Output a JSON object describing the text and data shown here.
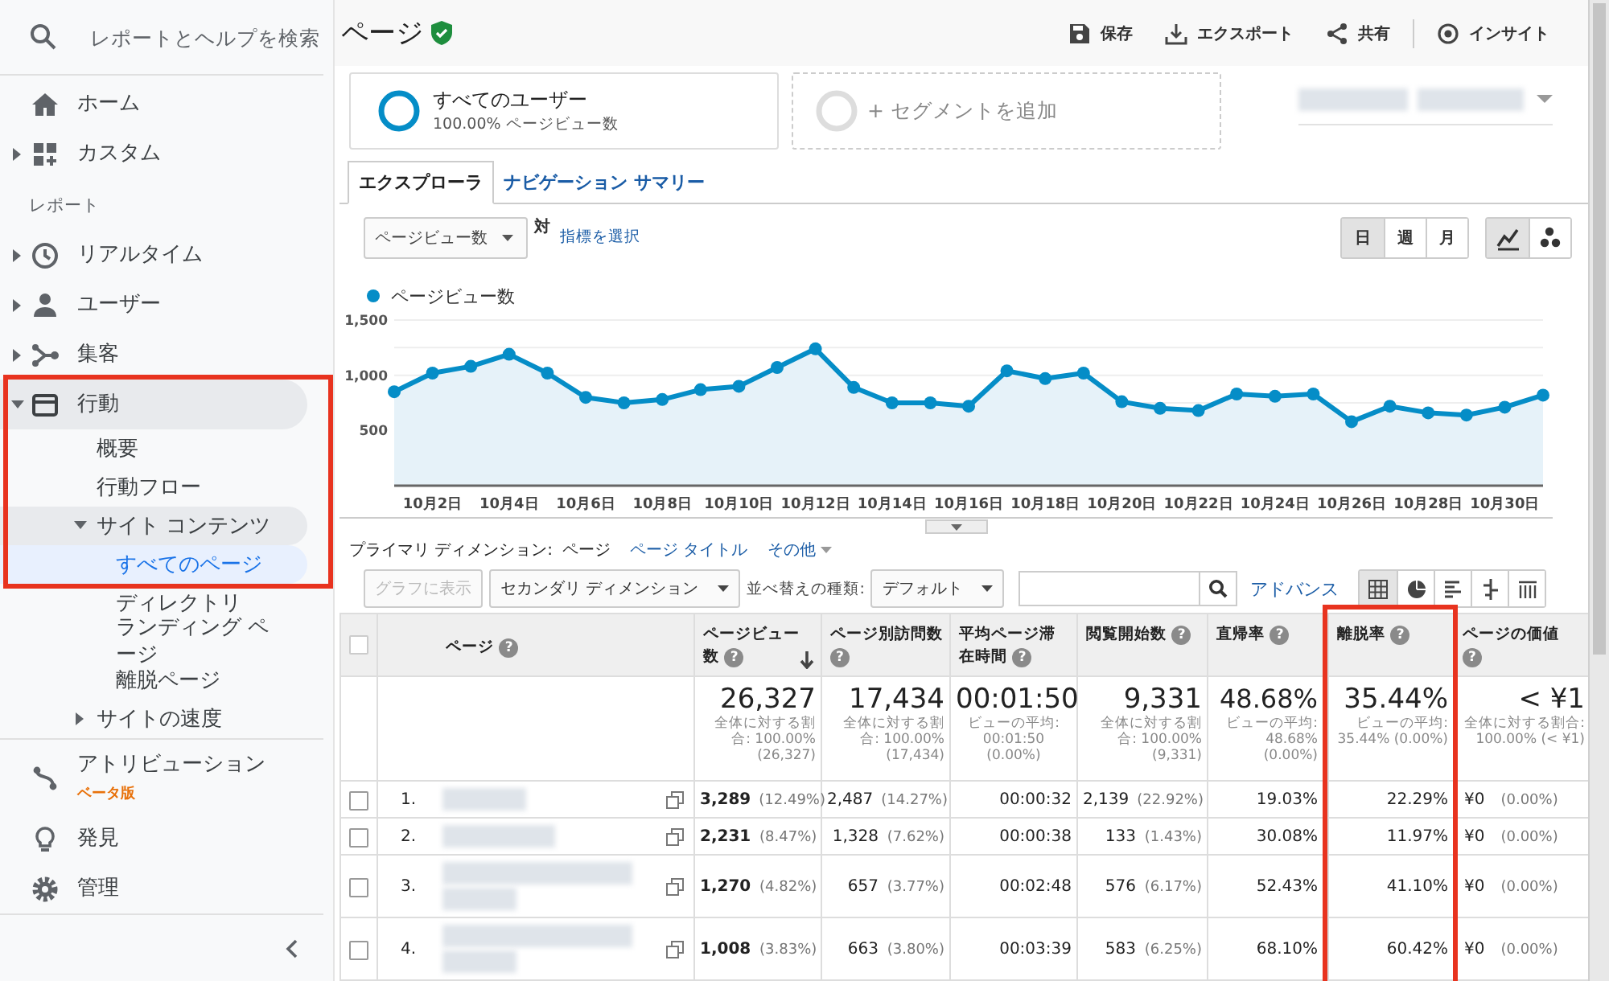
{
  "sidebar": {
    "search": {
      "placeholder": "レポートとヘルプを検索"
    },
    "top_items": [
      {
        "label": "ホーム",
        "selected": false
      },
      {
        "label": "カスタム",
        "expanded": false,
        "selected": false
      }
    ],
    "section_label": "レポート",
    "report_items": [
      {
        "label": "リアルタイム",
        "expanded": false,
        "selected": false
      },
      {
        "label": "ユーザー",
        "expanded": false,
        "selected": false
      },
      {
        "label": "集客",
        "expanded": false,
        "selected": false
      },
      {
        "label": "行動",
        "expanded": true,
        "selected": false,
        "highlighted": true,
        "children": [
          {
            "label": "概要",
            "selected": false
          },
          {
            "label": "行動フロー",
            "selected": false
          },
          {
            "label": "サイト コンテンツ",
            "expanded": true,
            "selected": false,
            "children": [
              {
                "label": "すべてのページ",
                "selected": true
              },
              {
                "label": "ディレクトリ",
                "selected": false
              },
              {
                "label": "ランディング ページ",
                "selected": false
              },
              {
                "label": "離脱ページ",
                "selected": false
              }
            ]
          },
          {
            "label": "サイトの速度",
            "expanded": false,
            "selected": false
          }
        ]
      }
    ],
    "bottom_items": [
      {
        "label": "アトリビューション",
        "badge": "ベータ版",
        "selected": false
      },
      {
        "label": "発見",
        "selected": false
      },
      {
        "label": "管理",
        "selected": false
      }
    ]
  },
  "header": {
    "title": "ページ",
    "verified": true,
    "actions": [
      {
        "label": "保存"
      },
      {
        "label": "エクスポート"
      },
      {
        "label": "共有"
      },
      {
        "label": "インサイト"
      }
    ]
  },
  "segments": [
    {
      "kind": "active",
      "name": "すべてのユーザー",
      "detail": "100.00% ページビュー数"
    },
    {
      "kind": "add",
      "name": "+ セグメントを追加"
    }
  ],
  "date_range": {
    "kind": "redacted"
  },
  "tabs": [
    {
      "label": "エクスプローラ",
      "selected": true
    },
    {
      "label": "ナビゲーション サマリー",
      "selected": false
    }
  ],
  "chart_controls": {
    "metric": "ページビュー数",
    "versus": "対",
    "pick_metric": "指標を選択",
    "periods": [
      {
        "label": "日",
        "selected": true
      },
      {
        "label": "週",
        "selected": false
      },
      {
        "label": "月",
        "selected": false
      }
    ],
    "chart_types": [
      {
        "selected": true
      },
      {
        "selected": false
      }
    ]
  },
  "chart": {
    "chart_data": {
      "type": "area",
      "categories": [
        null,
        "10月2日",
        null,
        "10月4日",
        null,
        "10月6日",
        null,
        "10月8日",
        null,
        "10月10日",
        null,
        "10月12日",
        null,
        "10月14日",
        null,
        "10月16日",
        null,
        "10月18日",
        null,
        "10月20日",
        null,
        "10月22日",
        null,
        "10月24日",
        null,
        "10月26日",
        null,
        "10月28日",
        null,
        "10月30日",
        null
      ],
      "ylim": [
        0,
        1500
      ],
      "yticks": [
        {
          "value": 500,
          "label": "500"
        },
        {
          "value": 1000,
          "label": "1,000"
        },
        {
          "value": 1500,
          "label": "1,500"
        }
      ],
      "series": [
        {
          "name": "ページビュー数",
          "color": "#058dc7",
          "values": [
            850,
            1020,
            1080,
            1190,
            1020,
            800,
            750,
            780,
            870,
            900,
            1070,
            1240,
            890,
            750,
            750,
            720,
            1040,
            970,
            1020,
            760,
            700,
            680,
            830,
            810,
            830,
            580,
            720,
            660,
            640,
            710,
            820
          ]
        }
      ]
    }
  },
  "primary_dimension": {
    "label": "プライマリ ディメンション:",
    "options": [
      {
        "label": "ページ",
        "selected": true
      },
      {
        "label": "ページ タイトル",
        "selected": false
      },
      {
        "label": "その他",
        "selected": false,
        "kind": "menu"
      }
    ]
  },
  "toolbar": {
    "plot_button": {
      "label": "グラフに表示",
      "disabled": true
    },
    "secondary": "セカンダリ ディメンション",
    "sort_label": "並べ替えの種類:",
    "sort": "デフォルト",
    "advanced": "アドバンス",
    "views": [
      {
        "selected": true
      },
      {
        "selected": false
      },
      {
        "selected": false
      },
      {
        "selected": false
      },
      {
        "selected": false
      }
    ]
  },
  "table": {
    "all_checked": false,
    "columns": [
      {
        "label": "ページ",
        "help": "?",
        "sorted": false
      },
      {
        "label": "ページビュー数",
        "help": "?",
        "sorted": true
      },
      {
        "label": "ページ別訪問数",
        "help": "?",
        "sorted": false
      },
      {
        "label": "平均ページ滞在時間",
        "help": "?",
        "sorted": false
      },
      {
        "label": "閲覧開始数",
        "help": "?",
        "sorted": false
      },
      {
        "label": "直帰率",
        "help": "?",
        "sorted": false
      },
      {
        "label": "離脱率",
        "help": "?",
        "sorted": false,
        "highlighted": true
      },
      {
        "label": "ページの価値",
        "help": "?",
        "sorted": false
      }
    ],
    "totals": [
      {
        "value": "26,327",
        "detail": "全体に対する割合: 100.00% (26,327)"
      },
      {
        "value": "17,434",
        "detail": "全体に対する割合: 100.00% (17,434)"
      },
      {
        "value": "00:01:50",
        "detail": "ビューの平均: 00:01:50 (0.00%)"
      },
      {
        "value": "9,331",
        "detail": "全体に対する割合: 100.00% (9,331)"
      },
      {
        "value": "48.68%",
        "detail": "ビューの平均: 48.68% (0.00%)"
      },
      {
        "value": "35.44%",
        "detail": "ビューの平均: 35.44% (0.00%)"
      },
      {
        "value": "< ¥1",
        "detail": "全体に対する割合: 100.00% (< ¥1)"
      }
    ],
    "rows": [
      {
        "checked": false,
        "cells": [
          {
            "number": "1.",
            "kind": "redacted-short"
          },
          {
            "value": "3,289",
            "share": "(12.49%)"
          },
          {
            "value": "2,487",
            "share": "(14.27%)"
          },
          {
            "value": "00:00:32"
          },
          {
            "value": "2,139",
            "share": "(22.92%)"
          },
          {
            "value": "19.03%"
          },
          {
            "value": "22.29%"
          },
          {
            "value": "¥0",
            "share": "(0.00%)"
          }
        ]
      },
      {
        "checked": false,
        "cells": [
          {
            "number": "2.",
            "kind": "redacted-medium"
          },
          {
            "value": "2,231",
            "share": "(8.47%)"
          },
          {
            "value": "1,328",
            "share": "(7.62%)"
          },
          {
            "value": "00:00:38"
          },
          {
            "value": "133",
            "share": "(1.43%)"
          },
          {
            "value": "30.08%"
          },
          {
            "value": "11.97%"
          },
          {
            "value": "¥0",
            "share": "(0.00%)"
          }
        ]
      },
      {
        "checked": false,
        "cells": [
          {
            "number": "3.",
            "kind": "redacted-long"
          },
          {
            "value": "1,270",
            "share": "(4.82%)"
          },
          {
            "value": "657",
            "share": "(3.77%)"
          },
          {
            "value": "00:02:48"
          },
          {
            "value": "576",
            "share": "(6.17%)"
          },
          {
            "value": "52.43%"
          },
          {
            "value": "41.10%"
          },
          {
            "value": "¥0",
            "share": "(0.00%)"
          }
        ]
      },
      {
        "checked": false,
        "cells": [
          {
            "number": "4.",
            "kind": "redacted-long"
          },
          {
            "value": "1,008",
            "share": "(3.83%)"
          },
          {
            "value": "663",
            "share": "(3.80%)"
          },
          {
            "value": "00:03:39"
          },
          {
            "value": "583",
            "share": "(6.25%)"
          },
          {
            "value": "68.10%"
          },
          {
            "value": "60.42%"
          },
          {
            "value": "¥0",
            "share": "(0.00%)"
          }
        ]
      }
    ]
  }
}
